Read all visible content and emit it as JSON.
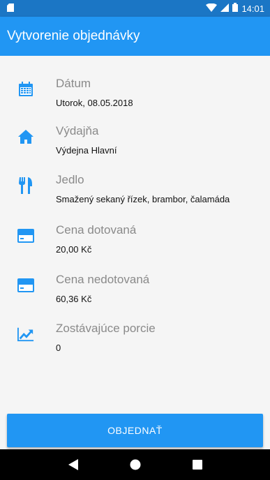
{
  "status_bar": {
    "time": "14:01"
  },
  "app_bar": {
    "title": "Vytvorenie objednávky"
  },
  "rows": [
    {
      "label": "Dátum",
      "value": "Utorok, 08.05.2018",
      "icon": "calendar-icon"
    },
    {
      "label": "Výdajňa",
      "value": "Výdejna Hlavní",
      "icon": "home-icon"
    },
    {
      "label": "Jedlo",
      "value": "Smažený sekaný řízek, brambor, čalamáda",
      "icon": "fork-knife-icon"
    },
    {
      "label": "Cena dotovaná",
      "value": "20,00 Kč",
      "icon": "credit-card-icon"
    },
    {
      "label": "Cena nedotovaná",
      "value": "60,36 Kč",
      "icon": "credit-card-icon"
    },
    {
      "label": "Zostávajúce porcie",
      "value": "0",
      "icon": "trending-up-icon"
    }
  ],
  "order_button": {
    "label": "OBJEDNAŤ"
  },
  "colors": {
    "primary": "#2196f3",
    "primary_dark": "#1b76c5",
    "label": "#8a8a8a"
  }
}
